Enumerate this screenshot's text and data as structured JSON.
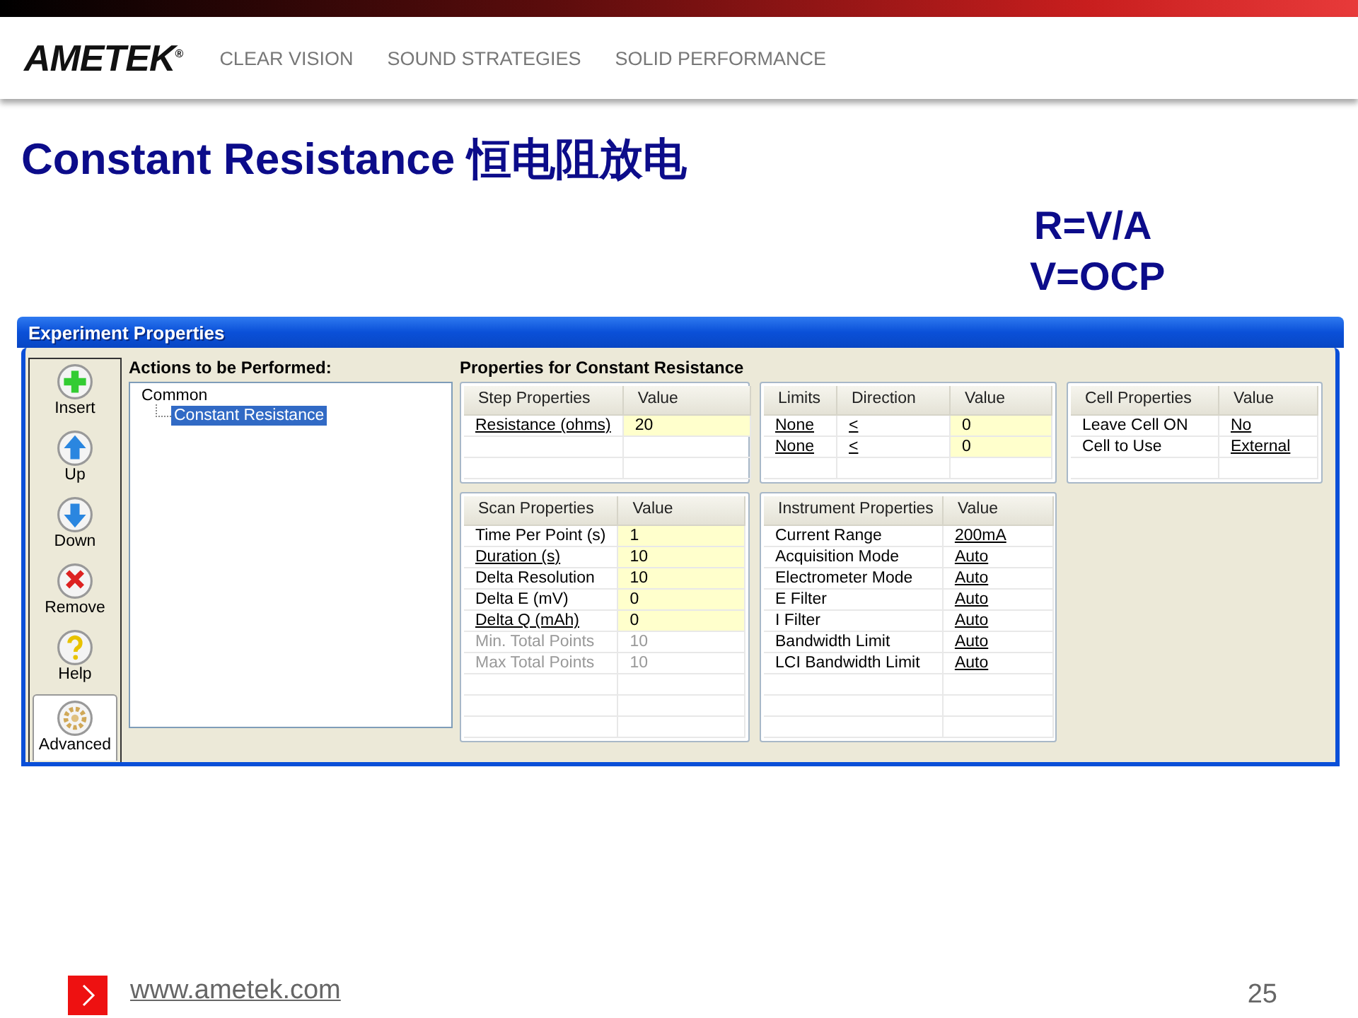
{
  "header": {
    "logo": "AMETEK$^{®}$",
    "taglines": [
      "CLEAR VISION",
      "SOUND STRATEGIES",
      "SOLID PERFORMANCE"
    ]
  },
  "title": "Constant Resistance 恒电阻放电",
  "formulas": [
    "R=V/A",
    "V=OCP"
  ],
  "window": {
    "title": "Experiment Properties",
    "toolbar": [
      {
        "label": "Insert",
        "kind": "insert",
        "selected": false
      },
      {
        "label": "Up",
        "kind": "up",
        "selected": false
      },
      {
        "label": "Down",
        "kind": "down",
        "selected": false
      },
      {
        "label": "Remove",
        "kind": "remove",
        "selected": false
      },
      {
        "label": "Help",
        "kind": "help",
        "selected": false
      },
      {
        "label": "Advanced",
        "kind": "advanced",
        "selected": true
      }
    ],
    "tree": {
      "heading": "Actions to be Performed:",
      "items": [
        {
          "label": "Common",
          "selected": false,
          "children": [
            {
              "label": "Constant Resistance",
              "selected": true
            }
          ]
        }
      ]
    },
    "properties_heading": "Properties for Constant Resistance",
    "tables": [
      {
        "columns": [
          "Step Properties",
          "Value"
        ],
        "rows": [
          {
            "cells": [
              {
                "text": "Resistance (ohms)",
                "linked": true,
                "editable": false,
                "disabled": false
              },
              {
                "text": "20",
                "linked": false,
                "editable": true,
                "disabled": false
              }
            ]
          }
        ]
      },
      {
        "columns": [
          "Limits",
          "Direction",
          "Value"
        ],
        "rows": [
          {
            "cells": [
              {
                "text": "None",
                "linked": true,
                "editable": false,
                "disabled": false
              },
              {
                "text": "<",
                "linked": true,
                "editable": false,
                "disabled": false
              },
              {
                "text": "0",
                "linked": false,
                "editable": true,
                "disabled": false
              }
            ]
          },
          {
            "cells": [
              {
                "text": "None",
                "linked": true,
                "editable": false,
                "disabled": false
              },
              {
                "text": "<",
                "linked": true,
                "editable": false,
                "disabled": false
              },
              {
                "text": "0",
                "linked": false,
                "editable": true,
                "disabled": false
              }
            ]
          }
        ]
      },
      {
        "columns": [
          "Cell Properties",
          "Value"
        ],
        "rows": [
          {
            "cells": [
              {
                "text": "Leave Cell ON",
                "linked": false,
                "editable": false,
                "disabled": false
              },
              {
                "text": "No",
                "linked": true,
                "editable": false,
                "disabled": false
              }
            ]
          },
          {
            "cells": [
              {
                "text": "Cell to Use",
                "linked": false,
                "editable": false,
                "disabled": false
              },
              {
                "text": "External",
                "linked": true,
                "editable": false,
                "disabled": false
              }
            ]
          }
        ]
      },
      {
        "columns": [
          "Scan Properties",
          "Value"
        ],
        "rows": [
          {
            "cells": [
              {
                "text": "Time Per Point (s)",
                "linked": false,
                "editable": false,
                "disabled": false
              },
              {
                "text": "1",
                "linked": false,
                "editable": true,
                "disabled": false
              }
            ]
          },
          {
            "cells": [
              {
                "text": "Duration (s)",
                "linked": true,
                "editable": false,
                "disabled": false
              },
              {
                "text": "10",
                "linked": false,
                "editable": true,
                "disabled": false
              }
            ]
          },
          {
            "cells": [
              {
                "text": "Delta Resolution",
                "linked": false,
                "editable": false,
                "disabled": false
              },
              {
                "text": "10",
                "linked": false,
                "editable": true,
                "disabled": false
              }
            ]
          },
          {
            "cells": [
              {
                "text": "Delta E (mV)",
                "linked": false,
                "editable": false,
                "disabled": false
              },
              {
                "text": "0",
                "linked": false,
                "editable": true,
                "disabled": false
              }
            ]
          },
          {
            "cells": [
              {
                "text": "Delta Q (mAh)",
                "linked": true,
                "editable": false,
                "disabled": false
              },
              {
                "text": "0",
                "linked": false,
                "editable": true,
                "disabled": false
              }
            ]
          },
          {
            "cells": [
              {
                "text": "Min. Total Points",
                "linked": false,
                "editable": false,
                "disabled": true
              },
              {
                "text": "10",
                "linked": false,
                "editable": false,
                "disabled": true
              }
            ]
          },
          {
            "cells": [
              {
                "text": "Max Total Points",
                "linked": false,
                "editable": false,
                "disabled": true
              },
              {
                "text": "10",
                "linked": false,
                "editable": false,
                "disabled": true
              }
            ]
          }
        ]
      },
      {
        "columns": [
          "Instrument Properties",
          "Value"
        ],
        "rows": [
          {
            "cells": [
              {
                "text": "Current Range",
                "linked": false,
                "editable": false,
                "disabled": false
              },
              {
                "text": "200mA",
                "linked": true,
                "editable": false,
                "disabled": false
              }
            ]
          },
          {
            "cells": [
              {
                "text": "Acquisition Mode",
                "linked": false,
                "editable": false,
                "disabled": false
              },
              {
                "text": "Auto",
                "linked": true,
                "editable": false,
                "disabled": false
              }
            ]
          },
          {
            "cells": [
              {
                "text": "Electrometer Mode",
                "linked": false,
                "editable": false,
                "disabled": false
              },
              {
                "text": "Auto",
                "linked": true,
                "editable": false,
                "disabled": false
              }
            ]
          },
          {
            "cells": [
              {
                "text": "E Filter",
                "linked": false,
                "editable": false,
                "disabled": false
              },
              {
                "text": "Auto",
                "linked": true,
                "editable": false,
                "disabled": false
              }
            ]
          },
          {
            "cells": [
              {
                "text": "I Filter",
                "linked": false,
                "editable": false,
                "disabled": false
              },
              {
                "text": "Auto",
                "linked": true,
                "editable": false,
                "disabled": false
              }
            ]
          },
          {
            "cells": [
              {
                "text": "Bandwidth Limit",
                "linked": false,
                "editable": false,
                "disabled": false
              },
              {
                "text": "Auto",
                "linked": true,
                "editable": false,
                "disabled": false
              }
            ]
          },
          {
            "cells": [
              {
                "text": "LCI Bandwidth Limit",
                "linked": false,
                "editable": false,
                "disabled": false
              },
              {
                "text": "Auto",
                "linked": true,
                "editable": false,
                "disabled": false
              }
            ]
          }
        ]
      }
    ]
  },
  "footer": {
    "url": "www.ametek.com",
    "page": "25"
  }
}
